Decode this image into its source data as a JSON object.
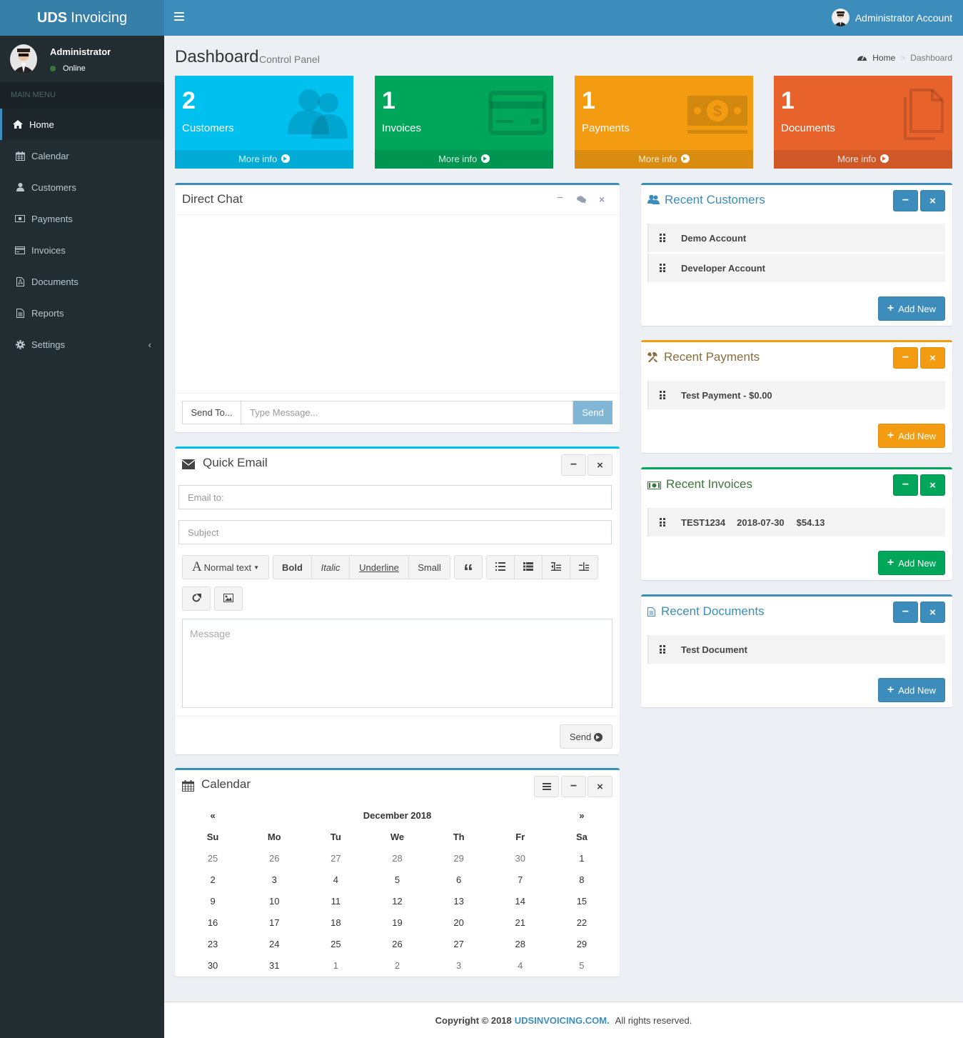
{
  "app": {
    "logo_bold": "UDS",
    "logo_rest": "Invoicing"
  },
  "header": {
    "account_label": "Administrator Account"
  },
  "sidebar": {
    "user_name": "Administrator",
    "user_status": "Online",
    "menu_header": "MAIN MENU",
    "items": [
      {
        "label": "Home",
        "icon": "home-icon"
      },
      {
        "label": "Calendar",
        "icon": "calendar-icon"
      },
      {
        "label": "Customers",
        "icon": "user-icon"
      },
      {
        "label": "Payments",
        "icon": "money-icon"
      },
      {
        "label": "Invoices",
        "icon": "credit-card-icon"
      },
      {
        "label": "Documents",
        "icon": "pdf-file-icon"
      },
      {
        "label": "Reports",
        "icon": "file-text-icon"
      },
      {
        "label": "Settings",
        "icon": "gear-icon"
      }
    ]
  },
  "page": {
    "title": "Dashboard",
    "subtitle": "Control Panel"
  },
  "breadcrumb": {
    "home": "Home",
    "current": "Dashboard"
  },
  "stats": [
    {
      "count": "2",
      "label": "Customers",
      "more": "More info",
      "color": "#00c0ef"
    },
    {
      "count": "1",
      "label": "Invoices",
      "more": "More info",
      "color": "#00a65a"
    },
    {
      "count": "1",
      "label": "Payments",
      "more": "More info",
      "color": "#f39c12"
    },
    {
      "count": "1",
      "label": "Documents",
      "more": "More info",
      "color": "#e8622c"
    }
  ],
  "direct_chat": {
    "title": "Direct Chat",
    "send_to": "Send To...",
    "placeholder": "Type Message...",
    "send": "Send"
  },
  "quick_email": {
    "title": "Quick Email",
    "email_to_placeholder": "Email to:",
    "subject_placeholder": "Subject",
    "toolbar": {
      "normal_text": "Normal text",
      "bold": "Bold",
      "italic": "Italic",
      "underline": "Underline",
      "small": "Small",
      "quote": "“"
    },
    "message_placeholder": "Message",
    "send": "Send"
  },
  "calendar": {
    "title": "Calendar",
    "prev": "«",
    "next": "»",
    "month": "December 2018",
    "days": [
      "Su",
      "Mo",
      "Tu",
      "We",
      "Th",
      "Fr",
      "Sa"
    ],
    "weeks": [
      [
        "25",
        "26",
        "27",
        "28",
        "29",
        "30",
        "1"
      ],
      [
        "2",
        "3",
        "4",
        "5",
        "6",
        "7",
        "8"
      ],
      [
        "9",
        "10",
        "11",
        "12",
        "13",
        "14",
        "15"
      ],
      [
        "16",
        "17",
        "18",
        "19",
        "20",
        "21",
        "22"
      ],
      [
        "23",
        "24",
        "25",
        "26",
        "27",
        "28",
        "29"
      ],
      [
        "30",
        "31",
        "1",
        "2",
        "3",
        "4",
        "5"
      ]
    ]
  },
  "recent_customers": {
    "title": "Recent Customers",
    "items": [
      "Demo Account",
      "Developer Account"
    ],
    "add": "Add New"
  },
  "recent_payments": {
    "title": "Recent Payments",
    "items": [
      "Test Payment - $0.00"
    ],
    "add": "Add New"
  },
  "recent_invoices": {
    "title": "Recent Invoices",
    "items": [
      {
        "number": "TEST1234",
        "date": "2018-07-30",
        "amount": "$54.13"
      }
    ],
    "add": "Add New"
  },
  "recent_documents": {
    "title": "Recent Documents",
    "items": [
      "Test Document"
    ],
    "add": "Add New"
  },
  "footer": {
    "copyright": "Copyright © 2018",
    "site": "UDSINVOICING.COM.",
    "rights": "All rights reserved."
  }
}
